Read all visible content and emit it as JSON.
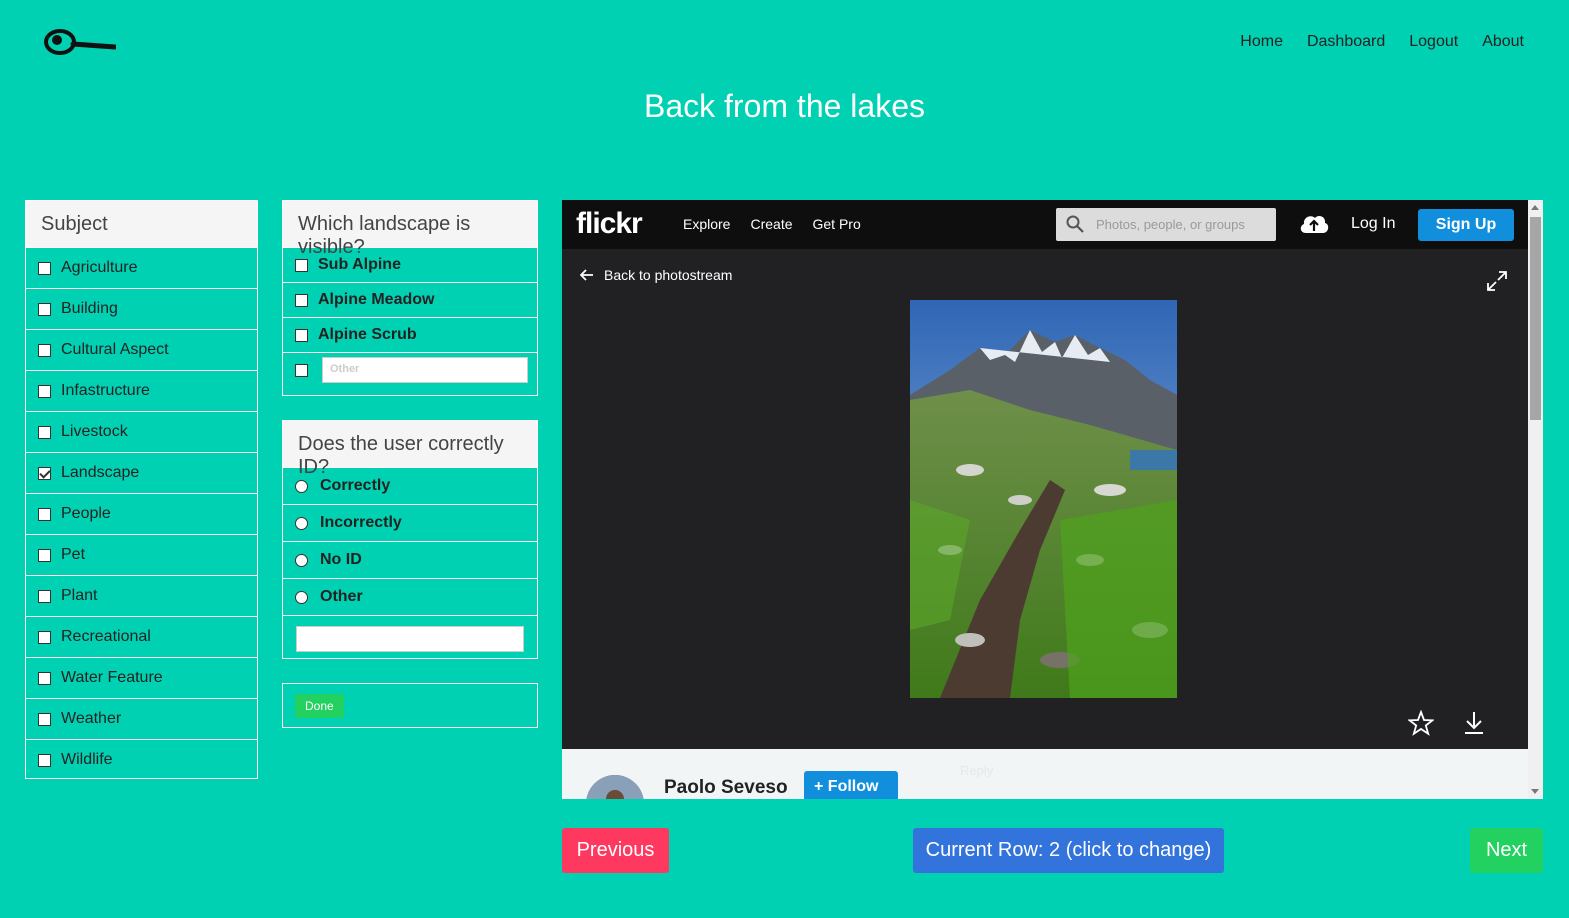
{
  "nav": {
    "items": [
      "Home",
      "Dashboard",
      "Logout",
      "About"
    ]
  },
  "page": {
    "title": "Back from the lakes"
  },
  "subject": {
    "header": "Subject",
    "items": [
      {
        "label": "Agriculture",
        "checked": false
      },
      {
        "label": "Building",
        "checked": false
      },
      {
        "label": "Cultural Aspect",
        "checked": false
      },
      {
        "label": "Infastructure",
        "checked": false
      },
      {
        "label": "Livestock",
        "checked": false
      },
      {
        "label": "Landscape",
        "checked": true
      },
      {
        "label": "People",
        "checked": false
      },
      {
        "label": "Pet",
        "checked": false
      },
      {
        "label": "Plant",
        "checked": false
      },
      {
        "label": "Recreational",
        "checked": false
      },
      {
        "label": "Water Feature",
        "checked": false
      },
      {
        "label": "Weather",
        "checked": false
      },
      {
        "label": "Wildlife",
        "checked": false
      }
    ]
  },
  "landscape": {
    "header": "Which landscape is visible?",
    "items": [
      "Sub Alpine",
      "Alpine Meadow",
      "Alpine Scrub"
    ],
    "other_placeholder": "Other"
  },
  "userid": {
    "header": "Does the user correctly ID?",
    "options": [
      "Correctly",
      "Incorrectly",
      "No ID",
      "Other"
    ],
    "other_value": ""
  },
  "done_label": "Done",
  "flickr": {
    "logo": "flickr",
    "menu": [
      "Explore",
      "Create",
      "Get Pro"
    ],
    "search_placeholder": "Photos, people, or groups",
    "login": "Log In",
    "signup": "Sign Up",
    "back": "Back to photostream",
    "owner_name": "Paolo Seveso",
    "follow": "Follow",
    "ghost_text": "Reply"
  },
  "buttons": {
    "previous": "Previous",
    "current_row": "Current Row: 2 (click to change)",
    "next": "Next"
  },
  "colors": {
    "background": "#00d1b2",
    "previous": "#ff3860",
    "current_row": "#3273dc",
    "next": "#23d160",
    "flickr_blue": "#128fdc"
  }
}
